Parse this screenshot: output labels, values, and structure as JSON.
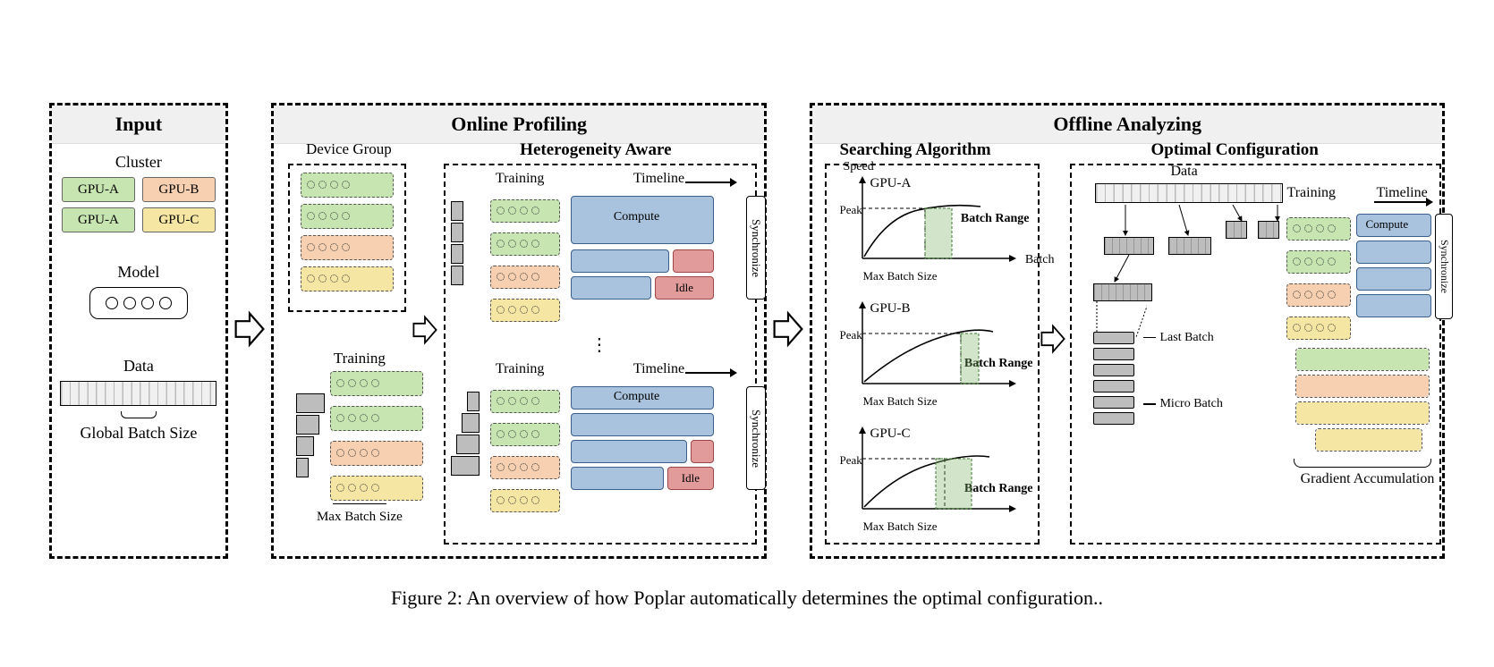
{
  "caption": "Figure 2: An overview of how Poplar automatically determines the optimal configuration..",
  "colors": {
    "gpu_a": "#c6e5b1",
    "gpu_b": "#f6d0b0",
    "gpu_c": "#f5e6a3",
    "compute": "#a9c2dd",
    "idle": "#e19b9b"
  },
  "input": {
    "title": "Input",
    "cluster_label": "Cluster",
    "gpus": [
      "GPU-A",
      "GPU-A",
      "GPU-B",
      "GPU-C"
    ],
    "model_label": "Model",
    "data_label": "Data",
    "global_batch_label": "Global Batch Size"
  },
  "online": {
    "title": "Online Profiling",
    "device_group_label": "Device Group",
    "training_label": "Training",
    "max_batch_label": "Max Batch Size",
    "heterogeneity_label": "Heterogeneity Aware",
    "timeline_label": "Timeline",
    "compute_label": "Compute",
    "idle_label": "Idle",
    "synchronize_label": "Synchronize"
  },
  "offline": {
    "title": "Offline Analyzing",
    "searching_label": "Searching Algorithm",
    "optimal_label": "Optimal Configuration",
    "plots": [
      {
        "gpu": "GPU-A",
        "ylabel": "Speed",
        "xlabel": "Batch",
        "peak_label": "Peak",
        "max_batch": "Max Batch Size",
        "batch_range": "Batch Range"
      },
      {
        "gpu": "GPU-B",
        "ylabel": "",
        "xlabel": "",
        "peak_label": "Peak",
        "max_batch": "Max Batch Size",
        "batch_range": "Batch Range"
      },
      {
        "gpu": "GPU-C",
        "ylabel": "",
        "xlabel": "",
        "peak_label": "Peak",
        "max_batch": "Max Batch Size",
        "batch_range": "Batch Range"
      }
    ],
    "data_label": "Data",
    "training_label": "Training",
    "timeline_label": "Timeline",
    "compute_label": "Compute",
    "synchronize_label": "Synchronize",
    "last_batch_label": "Last Batch",
    "micro_batch_label": "Micro Batch",
    "gradient_accum_label": "Gradient Accumulation"
  },
  "chart_data": [
    {
      "type": "line",
      "title": "GPU-A speed vs batch",
      "xlabel": "Batch",
      "ylabel": "Speed",
      "x": [
        0,
        0.2,
        0.4,
        0.6,
        0.8,
        1.0
      ],
      "y": [
        0,
        0.55,
        0.8,
        0.92,
        0.98,
        1.0
      ],
      "peak": 1.0,
      "batch_range": [
        0.55,
        0.8
      ],
      "max_batch_size_x": 0.8,
      "ylim": [
        0,
        1
      ],
      "xlim": [
        0,
        1
      ]
    },
    {
      "type": "line",
      "title": "GPU-B speed vs batch",
      "xlabel": "Batch",
      "ylabel": "Speed",
      "x": [
        0,
        0.2,
        0.4,
        0.6,
        0.8,
        1.0
      ],
      "y": [
        0,
        0.4,
        0.68,
        0.85,
        0.95,
        1.0
      ],
      "peak": 1.0,
      "batch_range": [
        0.78,
        0.95
      ],
      "max_batch_size_x": 0.78,
      "ylim": [
        0,
        1
      ],
      "xlim": [
        0,
        1
      ]
    },
    {
      "type": "line",
      "title": "GPU-C speed vs batch",
      "xlabel": "Batch",
      "ylabel": "Speed",
      "x": [
        0,
        0.2,
        0.4,
        0.6,
        0.8,
        1.0
      ],
      "y": [
        0,
        0.38,
        0.65,
        0.83,
        0.94,
        1.0
      ],
      "peak": 1.0,
      "batch_range": [
        0.6,
        0.9
      ],
      "max_batch_size_x": 0.72,
      "ylim": [
        0,
        1
      ],
      "xlim": [
        0,
        1
      ]
    }
  ]
}
